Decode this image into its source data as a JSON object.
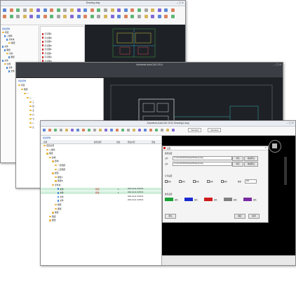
{
  "back_window": {
    "title": "Drawing.dwg",
    "panel_title": "组织结构",
    "tree": [
      "项目",
      "二维码",
      "文件夹",
      "图纸",
      "文件",
      "图纸",
      "文件",
      "图纸",
      "文件",
      "文件",
      "文件",
      "文件"
    ],
    "list": [
      "示意图A",
      "示意图B",
      "示意图C",
      "示意图D",
      "示意图E",
      "示意图F",
      "示意图G",
      "示意图H"
    ]
  },
  "mid_window": {
    "title": "Autodesk AutoCAD 2014",
    "panel_title": "组织结构",
    "tree": [
      "项目",
      "图纸",
      "一",
      "二",
      "三",
      "四",
      "五",
      "六",
      "七",
      "八",
      "九"
    ]
  },
  "front_window": {
    "title": "Autodesk AutoCAD 2014   Drawing1.dwg",
    "panel_title": "组织结构",
    "columns": [
      "名称",
      "操作说明",
      "状态",
      "修改时间",
      "添加"
    ],
    "rows": [
      {
        "name": "项目名称",
        "note": "",
        "status": "",
        "time": "",
        "highlight": false
      },
      {
        "name": "二维码",
        "note": "",
        "status": "",
        "time": "",
        "highlight": false
      },
      {
        "name": "图纸",
        "note": "",
        "status": "",
        "time": "",
        "highlight": false
      },
      {
        "name": "建筑",
        "note": "",
        "status": "",
        "time": "",
        "highlight": false
      },
      {
        "name": "结构",
        "note": "",
        "status": "",
        "time": "",
        "highlight": false
      },
      {
        "name": "一层图纸",
        "note": "",
        "status": "",
        "time": "",
        "highlight": false
      },
      {
        "name": "二层图纸",
        "note": "",
        "status": "",
        "time": "",
        "highlight": false
      },
      {
        "name": "模型",
        "note": "",
        "status": "",
        "time": "",
        "highlight": false
      },
      {
        "name": "图纸A",
        "note": "",
        "status": "",
        "time": "",
        "highlight": false
      },
      {
        "name": "图纸B",
        "note": "",
        "status": "",
        "time": "",
        "highlight": false
      },
      {
        "name": "文件夹",
        "note": "",
        "status": "",
        "time": "",
        "highlight": false
      },
      {
        "name": "文件",
        "note": "修改",
        "status": "1",
        "time": "2021-04-21 14:05:03",
        "highlight": true
      },
      {
        "name": "文件",
        "note": "修改",
        "status": "1",
        "time": "2021-04-21 14:05:03",
        "highlight": true
      },
      {
        "name": "文件",
        "note": "",
        "status": "",
        "time": "2021-04-21 14:05:03",
        "highlight": false
      },
      {
        "name": "文件",
        "note": "",
        "status": "",
        "time": "2021-04-21 14:05:03",
        "highlight": false
      },
      {
        "name": "图纸",
        "note": "",
        "status": "",
        "time": "",
        "highlight": false
      },
      {
        "name": "图纸",
        "note": "",
        "status": "",
        "time": "",
        "highlight": false
      },
      {
        "name": "图纸",
        "note": "",
        "status": "",
        "time": "",
        "highlight": false
      },
      {
        "name": "图纸",
        "note": "",
        "status": "",
        "time": "",
        "highlight": false
      },
      {
        "name": "图纸",
        "note": "",
        "status": "",
        "time": "",
        "highlight": false
      }
    ],
    "quick_access": [
      "Standard",
      "Standard"
    ]
  },
  "dialog": {
    "title": "设置",
    "section_path": "路径设置",
    "label_a": "文件",
    "label_b": "文件",
    "path_a": "C:\\Users\\Public\\Desktop\\Drawing1.dwg",
    "path_b": "C:\\Users\\Public\\Desktop\\Drawing2.dwg",
    "btn_browse": "浏览",
    "btn_reset": "恢复默认",
    "section_opts": "打印设置",
    "opts": [
      "选项",
      "选项",
      "选项",
      "选项",
      "选项"
    ],
    "num_label": "数量",
    "num_value": "200",
    "section_color": "颜色设置",
    "colors": [
      {
        "label": "颜色",
        "hex": "#1aa035"
      },
      {
        "label": "颜色",
        "hex": "#1a2ad0"
      },
      {
        "label": "颜色",
        "hex": "#d01a1a"
      },
      {
        "label": "颜色",
        "hex": "#808080"
      },
      {
        "label": "颜色",
        "hex": "#7a2aa0"
      }
    ],
    "btn_ok": "确定",
    "btn_cancel": "取消",
    "btn_default": "默认"
  },
  "colors": {
    "cad_bg": "#1e2227",
    "black_canvas": "#000000",
    "highlight_row": "#cfeedb",
    "ribbon_bg": "#f7f7f7"
  }
}
